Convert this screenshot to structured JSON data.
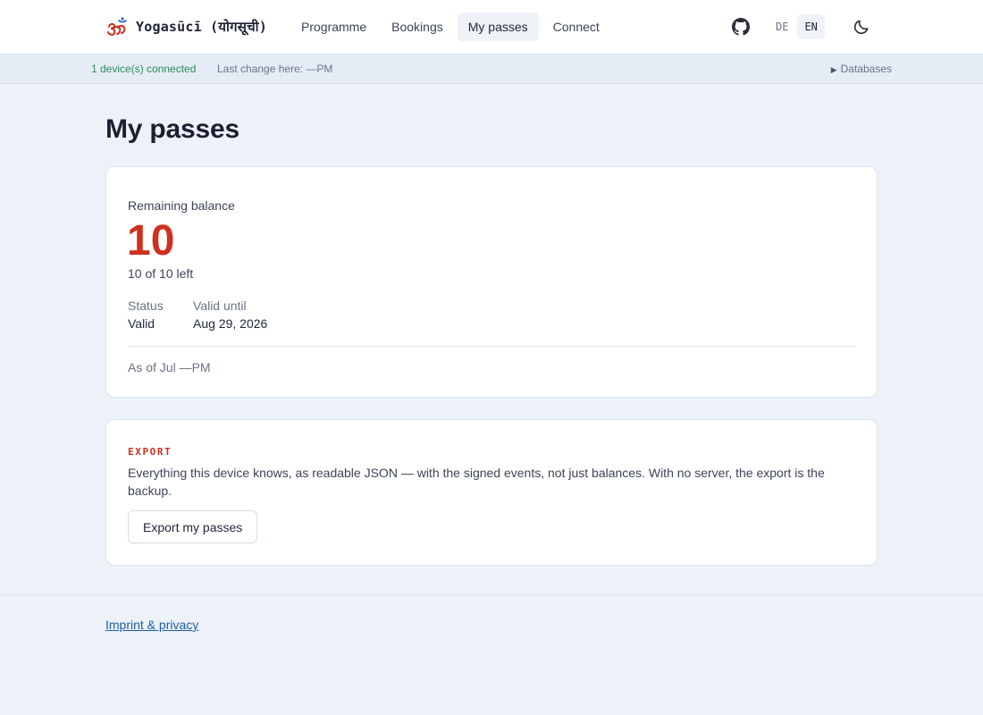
{
  "header": {
    "brand": "Yogasūcī (योगसूची)",
    "nav": [
      "Programme",
      "Bookings",
      "My passes",
      "Connect"
    ],
    "active_nav": "My passes",
    "languages": [
      "DE",
      "EN"
    ],
    "active_language": "EN",
    "icons": [
      "om-icon",
      "github-icon",
      "moon-icon"
    ]
  },
  "statusbar": {
    "connected": "1 device(s) connected",
    "last_change": "Last change here: —PM",
    "databases": "Databases"
  },
  "page": {
    "title": "My passes"
  },
  "balance_card": {
    "label": "Remaining balance",
    "value": "10",
    "subtext": "10 of 10 left",
    "status_label": "Status",
    "status_value": "Valid",
    "valid_until_label": "Valid until",
    "valid_until_value": "Aug 29, 2026",
    "as_of": "As of Jul —PM"
  },
  "export_card": {
    "kicker": "EXPORT",
    "description": "Everything this device knows, as readable JSON — with the signed events, not just balances. With no server, the export is the backup.",
    "button": "Export my passes"
  },
  "footer": {
    "link": "Imprint & privacy"
  },
  "colors": {
    "accent": "#d0301f",
    "connected": "#2b8a5e",
    "link": "#1d5fa8",
    "page_bg": "#edf1f8"
  }
}
